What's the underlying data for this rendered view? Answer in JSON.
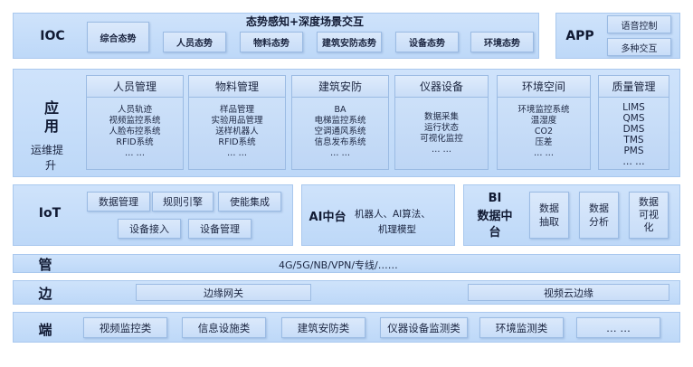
{
  "ioc": {
    "label": "IOC",
    "title": "态势感知+深度场景交互",
    "overview": "综合态势",
    "items": [
      "人员态势",
      "物料态势",
      "建筑安防态势",
      "设备态势",
      "环境态势"
    ]
  },
  "app": {
    "label": "APP",
    "items": [
      "语音控制",
      "多种交互"
    ]
  },
  "application": {
    "label_main_1": "应",
    "label_main_2": "用",
    "label_sub_1": "运维提",
    "label_sub_2": "升",
    "columns": [
      {
        "title": "人员管理",
        "lines": [
          "人员轨迹",
          "视频监控系统",
          "人脸布控系统",
          "RFID系统",
          "… …"
        ]
      },
      {
        "title": "物料管理",
        "lines": [
          "样品管理",
          "实验用品管理",
          "送样机器人",
          "RFID系统",
          "… …"
        ]
      },
      {
        "title": "建筑安防",
        "lines": [
          "BA",
          "电梯监控系统",
          "空调通风系统",
          "信息发布系统",
          "… …"
        ]
      },
      {
        "title": "仪器设备",
        "lines": [
          "数据采集",
          "运行状态",
          "可视化监控",
          "… …"
        ]
      },
      {
        "title": "环境空间",
        "lines": [
          "环境监控系统",
          "温湿度",
          "CO2",
          "压差",
          "… …"
        ]
      },
      {
        "title": "质量管理",
        "lines": [
          "LIMS",
          "QMS",
          "DMS",
          "TMS",
          "PMS",
          "… …"
        ]
      }
    ]
  },
  "iot": {
    "label": "IoT",
    "items": [
      "数据管理",
      "规则引擎",
      "使能集成",
      "设备接入",
      "设备管理"
    ]
  },
  "ai": {
    "label": "AI中台",
    "desc_1": "机器人、AI算法、",
    "desc_2": "机理模型"
  },
  "bi": {
    "label_1": "BI",
    "label_2": "数据中",
    "label_3": "台",
    "items": [
      {
        "l1": "数据",
        "l2": "抽取"
      },
      {
        "l1": "数据",
        "l2": "分析"
      },
      {
        "l1": "数据",
        "l2": "可视",
        "l3": "化"
      }
    ]
  },
  "guan": {
    "label": "管",
    "network": "4G/5G/NB/VPN/专线/……"
  },
  "bian": {
    "label": "边",
    "items": [
      "边缘网关",
      "视频云边缘"
    ]
  },
  "duan": {
    "label": "端",
    "items": [
      "视频监控类",
      "信息设施类",
      "建筑安防类",
      "仪器设备监测类",
      "环境监测类",
      "… …"
    ]
  },
  "colors": {
    "panel": "#c6ddf9",
    "box": "#d3e5fb",
    "border": "#9bbbe3",
    "text": "#1b2540"
  }
}
